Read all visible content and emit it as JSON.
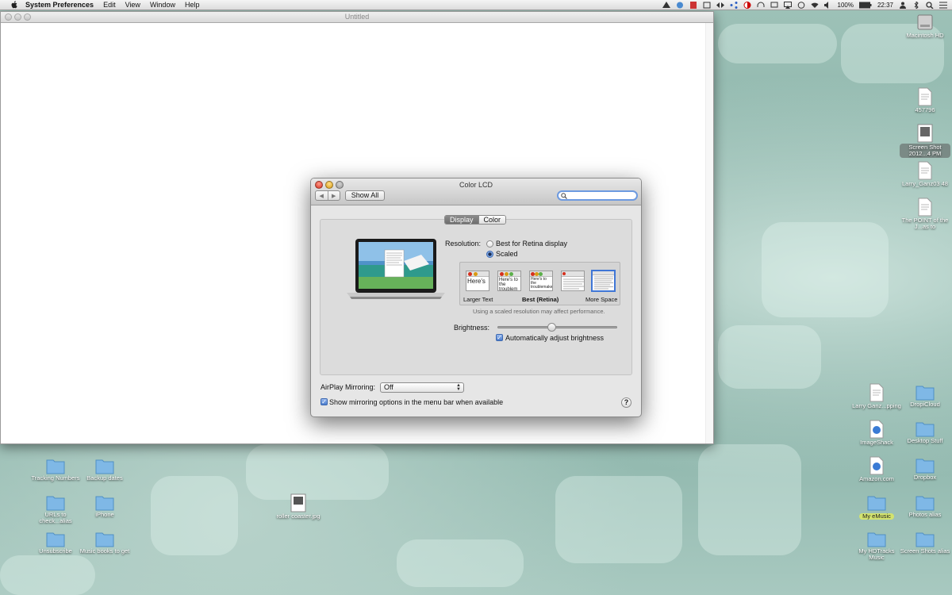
{
  "menubar": {
    "app_name": "System Preferences",
    "menus": [
      "Edit",
      "View",
      "Window",
      "Help"
    ],
    "battery": "100%",
    "clock": "22:37"
  },
  "untitled_window": {
    "title": "Untitled"
  },
  "lcd_window": {
    "title": "Color LCD",
    "show_all": "Show All",
    "search_placeholder": "",
    "tabs": [
      "Display",
      "Color"
    ],
    "active_tab": "Display",
    "resolution_label": "Resolution:",
    "option_best": "Best for Retina display",
    "option_scaled": "Scaled",
    "selected_option": "Scaled",
    "scale_captions": {
      "larger": "Larger Text",
      "best": "Best (Retina)",
      "more": "More Space"
    },
    "thumb_texts": [
      "Here's",
      "Here's to the troublem",
      "Here's to the troublemakers",
      "",
      ""
    ],
    "selected_scale": 4,
    "perf_note": "Using a scaled resolution may affect performance.",
    "brightness_label": "Brightness:",
    "brightness_level": 0.45,
    "auto_brightness": "Automatically adjust brightness",
    "auto_brightness_checked": true,
    "airplay_label": "AirPlay Mirroring:",
    "airplay_value": "Off",
    "show_mirroring": "Show mirroring options in the menu bar when available",
    "show_mirroring_checked": true,
    "help": "?"
  },
  "desktop_icons": {
    "macintosh_hd": "Macintosh HD",
    "file_457": "457796",
    "screen_shot": "Screen Shot 2012...4 PM",
    "larry_ganz_1": "Larry_Ganz03 48",
    "the_point": "The POINT of the J...as to",
    "larry_ganz_2": "Larry Ganz...pping",
    "dropicloud": "DropiCloud",
    "imageshack": "ImageShack",
    "desktop_stuff": "Desktop Stuff",
    "amazon": "Amazon.com",
    "dropbox": "Dropbox",
    "my_emusic": "My eMusic",
    "photos_alias": "Photos alias",
    "my_hdtracks": "My HDTracks Music",
    "screen_shots_alias": "Screen Shots alias",
    "tracking": "Tracking Numbers",
    "backup_dates": "Backup dates",
    "urls": "URLs to check...alias",
    "iphone": "iPhone",
    "unsubscribe": "Unsubscribe",
    "music_books": "Music books to get",
    "roller_coaster": "roller coaster.jpg"
  },
  "colors": {
    "folder": "#7fb8e6",
    "accent": "#3f76d6",
    "close": "#d5301e",
    "minimize": "#d99a12"
  }
}
